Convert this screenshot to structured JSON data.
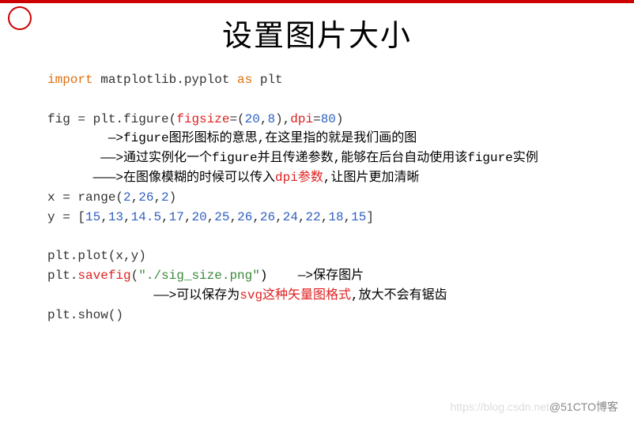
{
  "title": "设置图片大小",
  "code": {
    "l1_a": "import",
    "l1_b": " matplotlib.pyplot ",
    "l1_c": "as",
    "l1_d": " plt",
    "l2_a": "fig = plt.figure(",
    "l2_b": "figsize",
    "l2_c": "=(",
    "l2_d": "20",
    "l2_e": ",",
    "l2_f": "8",
    "l2_g": "),",
    "l2_h": "dpi",
    "l2_i": "=",
    "l2_j": "80",
    "l2_k": ")",
    "l3": "        —>figure图形图标的意思,在这里指的就是我们画的图",
    "l4": "       ——>通过实例化一个figure并且传递参数,能够在后台自动使用该figure实例",
    "l5_a": "      ———>在图像模糊的时候可以传入",
    "l5_b": "dpi参数",
    "l5_c": ",让图片更加清晰",
    "l6_a": "x = range(",
    "l6_b": "2",
    "l6_c": ",",
    "l6_d": "26",
    "l6_e": ",",
    "l6_f": "2",
    "l6_g": ")",
    "l7_a": "y = [",
    "l7_b": "15",
    "l7_c": ",",
    "l7_d": "13",
    "l7_e": ",",
    "l7_f": "14.5",
    "l7_g": ",",
    "l7_h": "17",
    "l7_i": ",",
    "l7_j": "20",
    "l7_k": ",",
    "l7_l": "25",
    "l7_m": ",",
    "l7_n": "26",
    "l7_o": ",",
    "l7_p": "26",
    "l7_q": ",",
    "l7_r": "24",
    "l7_s": ",",
    "l7_t": "22",
    "l7_u": ",",
    "l7_v": "18",
    "l7_w": ",",
    "l7_x": "15",
    "l7_y": "]",
    "l8": "plt.plot(x,y)",
    "l9_a": "plt.",
    "l9_b": "savefig",
    "l9_c": "(",
    "l9_d": "\"./sig_size.png\"",
    "l9_e": ")    —>保存图片",
    "l10_a": "              ——>可以保存为",
    "l10_b": "svg这种矢量图格式",
    "l10_c": ",放大不会有锯齿",
    "l11": "plt.show()"
  },
  "watermark": {
    "faint": "https://blog.csdn.net",
    "main": "@51CTO博客"
  }
}
